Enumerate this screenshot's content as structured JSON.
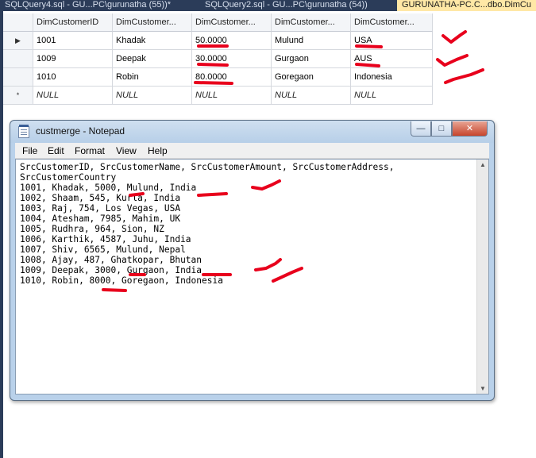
{
  "tabs": [
    {
      "label": "SQLQuery4.sql - GU...PC\\gurunatha (55))*"
    },
    {
      "label": "SQLQuery2.sql - GU...PC\\gurunatha (54))"
    },
    {
      "label": "GURUNATHA-PC.C...dbo.DimCu"
    }
  ],
  "grid": {
    "columns": [
      "DimCustomerID",
      "DimCustomer...",
      "DimCustomer...",
      "DimCustomer...",
      "DimCustomer..."
    ],
    "rows": [
      {
        "selector": "▶",
        "cells": [
          "1001",
          "Khadak",
          "50.0000",
          "Mulund",
          "USA"
        ]
      },
      {
        "selector": "",
        "cells": [
          "1009",
          "Deepak",
          "30.0000",
          "Gurgaon",
          "AUS"
        ]
      },
      {
        "selector": "",
        "cells": [
          "1010",
          "Robin",
          "80.0000",
          "Goregaon",
          "Indonesia"
        ]
      },
      {
        "selector": "*",
        "cells": [
          "NULL",
          "NULL",
          "NULL",
          "NULL",
          "NULL"
        ]
      }
    ]
  },
  "notepad": {
    "title": "custmerge - Notepad",
    "buttons": {
      "minimize": "—",
      "maximize": "□",
      "close": "✕"
    },
    "menu": [
      "File",
      "Edit",
      "Format",
      "View",
      "Help"
    ],
    "lines": [
      "SrcCustomerID, SrcCustomerName, SrcCustomerAmount, SrcCustomerAddress,",
      "SrcCustomerCountry",
      "1001, Khadak, 5000, Mulund, India",
      "1002, Shaam, 545, Kurla, India",
      "1003, Raj, 754, Los Vegas, USA",
      "1004, Atesham, 7985, Mahim, UK",
      "1005, Rudhra, 964, Sion, NZ",
      "1006, Karthik, 4587, Juhu, India",
      "1007, Shiv, 6565, Mulund, Nepal",
      "1008, Ajay, 487, Ghatkopar, Bhutan",
      "1009, Deepak, 3000, Gurgaon, India",
      "1010, Robin, 8000, Goregaon, Indonesia"
    ]
  },
  "colors": {
    "annotation": "#e8001c",
    "tab_active": "#ffe8a6",
    "tab_strip": "#2b3c59"
  }
}
